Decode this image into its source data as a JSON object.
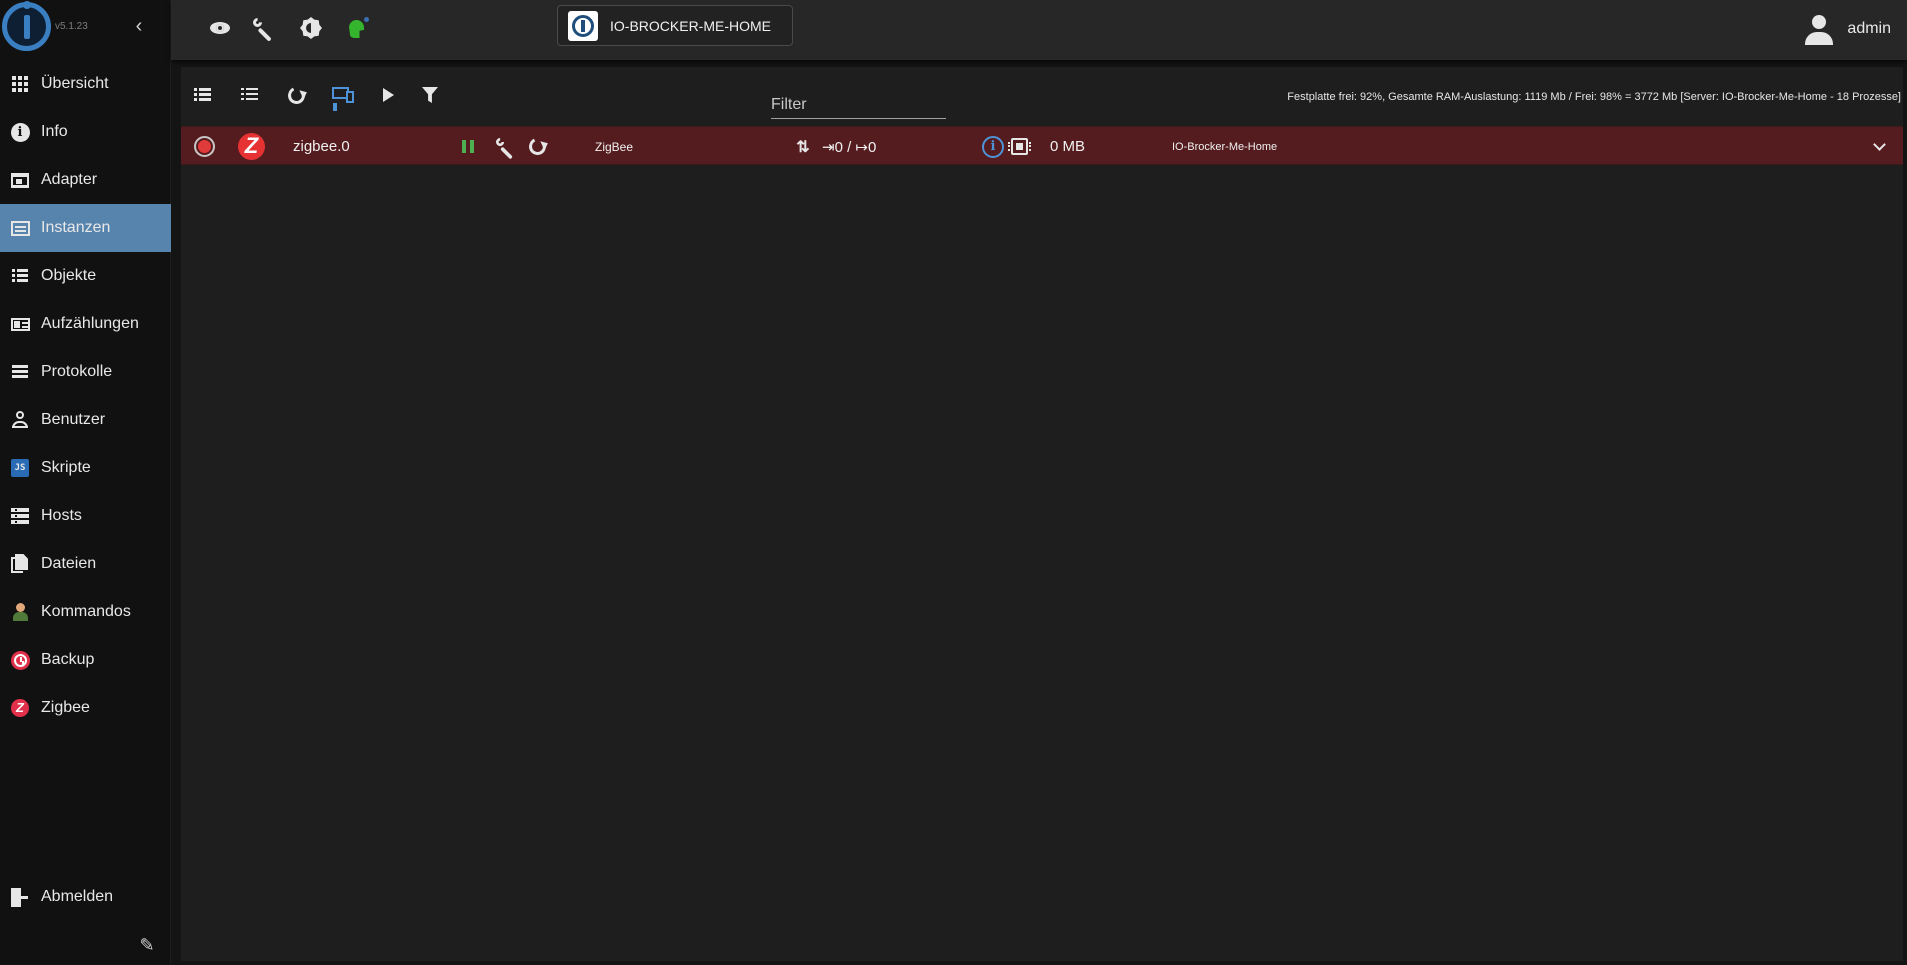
{
  "sidebar": {
    "version": "v5.1.23",
    "items": [
      {
        "label": "Übersicht",
        "icon": "grid-icon"
      },
      {
        "label": "Info",
        "icon": "info-icon"
      },
      {
        "label": "Adapter",
        "icon": "store-icon"
      },
      {
        "label": "Instanzen",
        "icon": "subtitles-icon",
        "active": true
      },
      {
        "label": "Objekte",
        "icon": "list-icon"
      },
      {
        "label": "Aufzählungen",
        "icon": "enum-icon"
      },
      {
        "label": "Protokolle",
        "icon": "log-icon"
      },
      {
        "label": "Benutzer",
        "icon": "person-icon"
      },
      {
        "label": "Skripte",
        "icon": "javascript-icon"
      },
      {
        "label": "Hosts",
        "icon": "hosts-icon"
      },
      {
        "label": "Dateien",
        "icon": "files-icon"
      },
      {
        "label": "Kommandos",
        "icon": "command-icon"
      },
      {
        "label": "Backup",
        "icon": "backup-icon"
      },
      {
        "label": "Zigbee",
        "icon": "zigbee-icon"
      }
    ],
    "logout_label": "Abmelden"
  },
  "topbar": {
    "host_label": "IO-BROCKER-ME-HOME",
    "user_name": "admin"
  },
  "toolbar": {
    "filter_placeholder": "Filter",
    "host_stats": "Festplatte frei: 92%, Gesamte RAM-Auslastung: 1119 Mb / Frei: 98% = 3772 Mb [Server: IO-Brocker-Me-Home - 18 Prozesse]"
  },
  "instances": [
    {
      "name": "zigbee.0",
      "title": "ZigBee",
      "events": "⇥0 / ↦0",
      "memory": "0 MB",
      "host": "IO-Brocker-Me-Home",
      "status": "stopped"
    }
  ],
  "colors": {
    "accent": "#5784ad",
    "row_background": "#541c1f",
    "status_red": "#e03a3a",
    "pause_green": "#4caf50",
    "info_blue": "#4e93d8"
  }
}
